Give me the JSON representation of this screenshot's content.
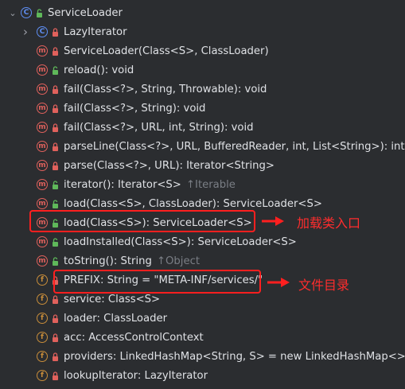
{
  "root": {
    "label": "ServiceLoader",
    "icon": "class-icon",
    "access": "public"
  },
  "items": [
    {
      "kind": "c",
      "access": "private",
      "label": "LazyIterator",
      "hint": "",
      "expandable": true
    },
    {
      "kind": "m",
      "access": "private",
      "label": "ServiceLoader(Class<S>, ClassLoader)",
      "hint": ""
    },
    {
      "kind": "m",
      "access": "public",
      "label": "reload(): void",
      "hint": ""
    },
    {
      "kind": "m",
      "access": "private",
      "label": "fail(Class<?>, String, Throwable): void",
      "hint": ""
    },
    {
      "kind": "m",
      "access": "private",
      "label": "fail(Class<?>, String): void",
      "hint": ""
    },
    {
      "kind": "m",
      "access": "private",
      "label": "fail(Class<?>, URL, int, String): void",
      "hint": ""
    },
    {
      "kind": "m",
      "access": "private",
      "label": "parseLine(Class<?>, URL, BufferedReader, int, List<String>): int",
      "hint": ""
    },
    {
      "kind": "m",
      "access": "private",
      "label": "parse(Class<?>, URL): Iterator<String>",
      "hint": ""
    },
    {
      "kind": "m",
      "access": "public",
      "label": "iterator(): Iterator<S>",
      "hint": "↑Iterable"
    },
    {
      "kind": "m",
      "access": "public",
      "label": "load(Class<S>, ClassLoader): ServiceLoader<S>",
      "hint": ""
    },
    {
      "kind": "m",
      "access": "public",
      "label": "load(Class<S>): ServiceLoader<S>",
      "hint": ""
    },
    {
      "kind": "m",
      "access": "public",
      "label": "loadInstalled(Class<S>): ServiceLoader<S>",
      "hint": ""
    },
    {
      "kind": "m",
      "access": "public",
      "label": "toString(): String",
      "hint": "↑Object"
    },
    {
      "kind": "f",
      "access": "private",
      "label": "PREFIX: String = \"META-INF/services/\"",
      "hint": ""
    },
    {
      "kind": "f",
      "access": "private",
      "label": "service: Class<S>",
      "hint": ""
    },
    {
      "kind": "f",
      "access": "private",
      "label": "loader: ClassLoader",
      "hint": ""
    },
    {
      "kind": "f",
      "access": "private",
      "label": "acc: AccessControlContext",
      "hint": ""
    },
    {
      "kind": "f",
      "access": "private",
      "label": "providers: LinkedHashMap<String, S> = new LinkedHashMap<>()",
      "hint": ""
    },
    {
      "kind": "f",
      "access": "private",
      "label": "lookupIterator: LazyIterator",
      "hint": ""
    }
  ],
  "annotations": [
    {
      "text": "加载类入口",
      "target_index": 10
    },
    {
      "text": "文件目录",
      "target_index": 13
    }
  ],
  "colors": {
    "background": "#2b2d30",
    "text": "#dfe1e5",
    "hint": "#7a7e85",
    "class_icon": "#5f8ff5",
    "method_icon": "#e0615c",
    "field_icon": "#c88d3a",
    "public_access": "#5fb85a",
    "private_access": "#e0615c",
    "annotation": "#ff1f1f"
  }
}
